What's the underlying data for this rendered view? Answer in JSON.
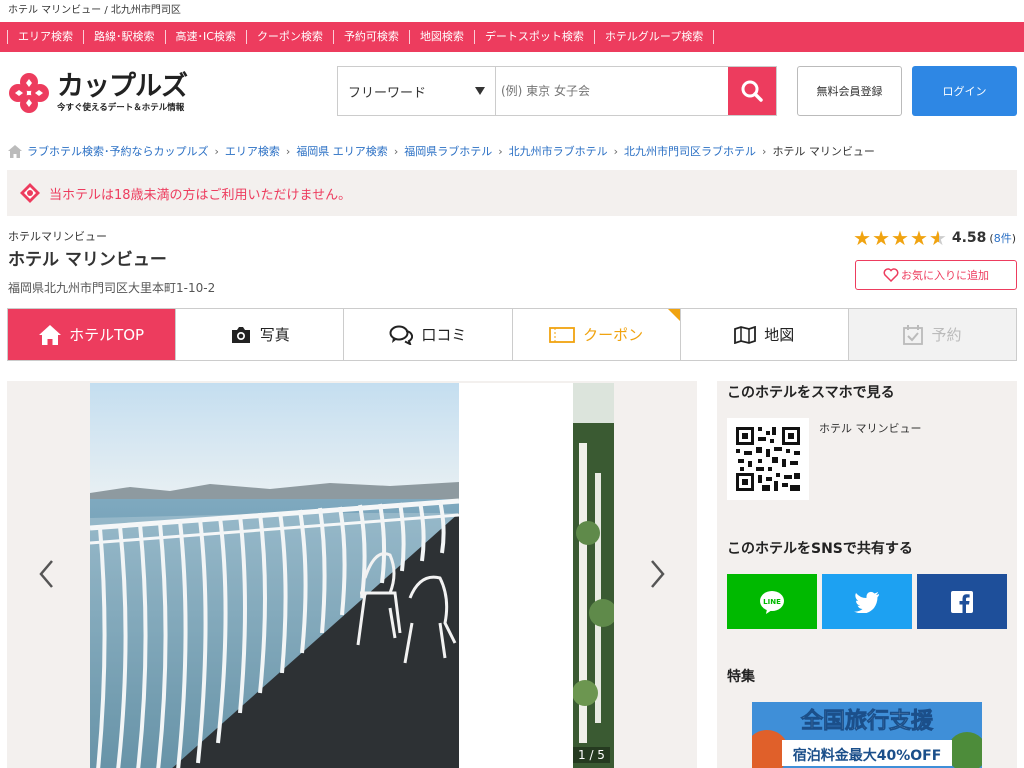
{
  "page": {
    "topline": "ホテル マリンビュー / 北九州市門司区"
  },
  "catnav": [
    "エリア検索",
    "路線･駅検索",
    "高速･IC検索",
    "クーポン検索",
    "予約可検索",
    "地図検索",
    "デートスポット検索",
    "ホテルグループ検索"
  ],
  "header": {
    "logo_main": "カップルズ",
    "logo_sub": "今すぐ使えるデート＆ホテル情報",
    "search_select": "フリーワード",
    "search_placeholder": "(例) 東京 女子会",
    "register": "無料会員登録",
    "login": "ログイン"
  },
  "breadcrumb": [
    "ラブホテル検索･予約ならカップルズ",
    "エリア検索",
    "福岡県 エリア検索",
    "福岡県ラブホテル",
    "北九州市ラブホテル",
    "北九州市門司区ラブホテル",
    "ホテル マリンビュー"
  ],
  "notice": "当ホテルは18歳未満の方はご利用いただけません。",
  "hotel": {
    "name_small": "ホテルマリンビュー",
    "name": "ホテル マリンビュー",
    "address": "福岡県北九州市門司区大里本町1-10-2",
    "rating": "4.58",
    "reviews": "8件",
    "favorite": "お気に入りに追加"
  },
  "tabs": [
    {
      "label": "ホテルTOP",
      "icon": "home-icon"
    },
    {
      "label": "写真",
      "icon": "camera-icon"
    },
    {
      "label": "口コミ",
      "icon": "chat-icon"
    },
    {
      "label": "クーポン",
      "icon": "ticket-icon"
    },
    {
      "label": "地図",
      "icon": "map-icon"
    },
    {
      "label": "予約",
      "icon": "calendar-check-icon"
    }
  ],
  "gallery": {
    "counter": "1 / 5"
  },
  "sidebar": {
    "smartphone_title": "このホテルをスマホで見る",
    "qr_name": "ホテル マリンビュー",
    "share_title": "このホテルをSNSで共有する",
    "share_buttons": [
      "LINE",
      "Twitter",
      "Facebook"
    ],
    "feature_title": "特集",
    "banner_line1": "全国旅行支援",
    "banner_line2": "宿泊料金最大40%OFF"
  },
  "colors": {
    "accent": "#ed3c5e",
    "link": "#2a6fc4",
    "star": "#f0a310",
    "line": "#00b900",
    "twitter": "#1da1f2",
    "facebook": "#1e4f9a"
  }
}
